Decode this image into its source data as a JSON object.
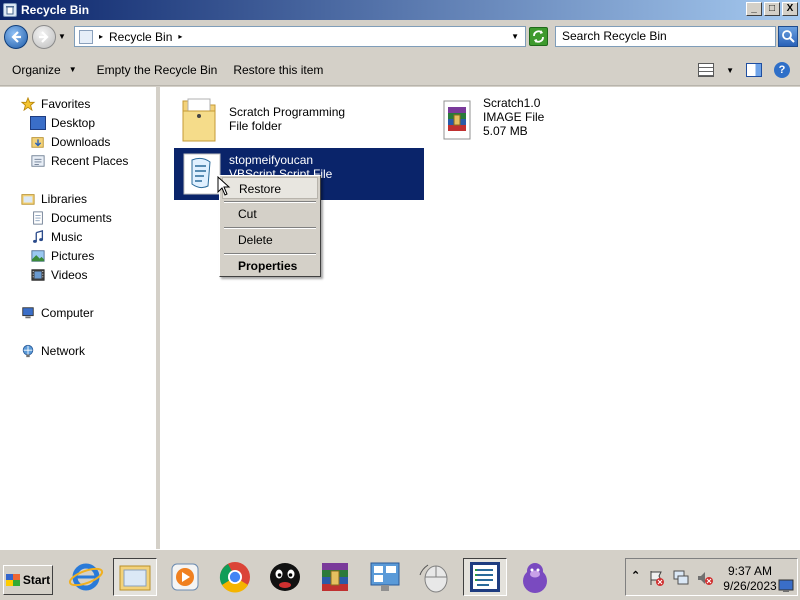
{
  "window": {
    "title": "Recycle Bin",
    "controls": [
      "_",
      "□",
      "X"
    ]
  },
  "address": {
    "crumb": "Recycle Bin",
    "search_placeholder": "Search Recycle Bin"
  },
  "toolbar": {
    "organize": "Organize",
    "empty": "Empty the Recycle Bin",
    "restore": "Restore this item"
  },
  "nav": {
    "favorites": "Favorites",
    "desktop": "Desktop",
    "downloads": "Downloads",
    "recent": "Recent Places",
    "libraries": "Libraries",
    "documents": "Documents",
    "music": "Music",
    "pictures": "Pictures",
    "videos": "Videos",
    "computer": "Computer",
    "network": "Network"
  },
  "files": [
    {
      "name": "Scratch Programming",
      "type": "File folder",
      "icon": "folder-icon"
    },
    {
      "name": "Scratch1.0",
      "type": "IMAGE File",
      "size": "5.07 MB",
      "icon": "winrar-archive-icon"
    },
    {
      "name": "stopmeifyoucan",
      "type": "VBScript Script File",
      "icon": "vbscript-icon"
    }
  ],
  "context_menu": {
    "restore": "Restore",
    "cut": "Cut",
    "delete": "Delete",
    "properties": "Properties"
  },
  "taskbar": {
    "start": "Start",
    "apps": [
      "internet-explorer-icon",
      "windows-explorer-icon",
      "media-player-icon",
      "chrome-icon",
      "pingu-icon",
      "winrar-icon",
      "control-panel-icon",
      "mouse-icon",
      "task-list-icon",
      "bonzi-icon"
    ],
    "time": "9:37 AM",
    "date": "9/26/2023"
  },
  "colors": {
    "selection": "#0a246a",
    "title_start": "#0a246a",
    "title_end": "#a6caf0"
  }
}
